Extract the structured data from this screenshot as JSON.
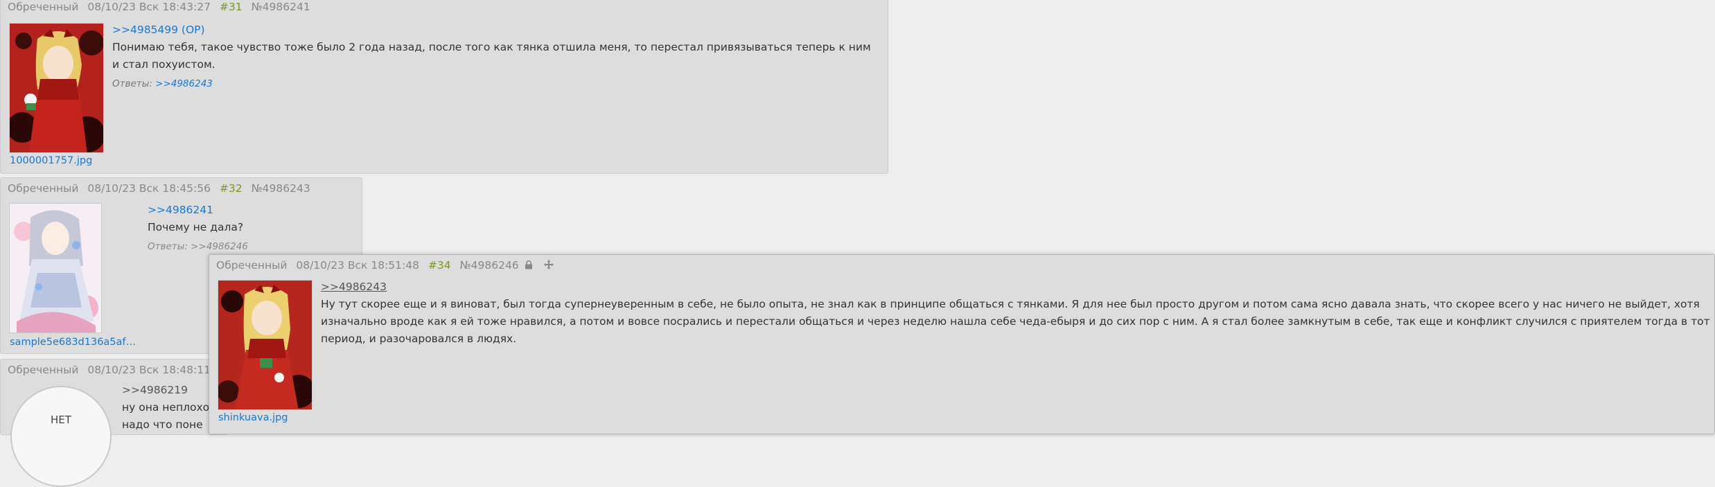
{
  "posts": [
    {
      "author": "Обреченный",
      "datetime": "08/10/23 Вск 18:43:27",
      "postnum": "#31",
      "id": "№4986241",
      "reply_to": ">>4985499 (OP)",
      "text_lines": [
        "Понимаю тебя, такое чувство тоже было 2 года назад, после того как тянка отшила меня, то перестал привязываться теперь к ним",
        "и стал похуистом."
      ],
      "answers_label": "Ответы:",
      "answers_link": ">>4986243",
      "file_name": "1000001757.jpg"
    },
    {
      "author": "Обреченный",
      "datetime": "08/10/23 Вск 18:45:56",
      "postnum": "#32",
      "id": "№4986243",
      "reply_to": ">>4986241",
      "text_lines": [
        "Почему не дала?"
      ],
      "answers_label": "Ответы:",
      "answers_link": ">>4986246",
      "file_name": "sample5e683d136a5af853..."
    },
    {
      "author": "Обреченный",
      "datetime": "08/10/23 Вск 18:48:11",
      "reply_to": ">>4986219",
      "text_lines": [
        "ну она неплохо",
        "надо что поне"
      ],
      "no_image_label": "НЕТ"
    }
  ],
  "popup": {
    "author": "Обреченный",
    "datetime": "08/10/23 Вск 18:51:48",
    "postnum": "#34",
    "id": "№4986246",
    "lock_icon": "lock-icon",
    "move_icon": "move-icon",
    "reply_to": ">>4986243",
    "text_lines": [
      "Ну тут скорее еще и я виноват, был тогда супернеуверенным в себе, не было опыта, не знал как в принципе общаться с тянками. Я для нее был просто другом и потом сама ясно давала знать, что скорее всего у нас ничего не выйдет, хотя",
      "изначально вроде как я ей тоже нравился, а потом и вовсе посрались и перестали общаться и через неделю нашла себе чеда-ебыря и до сих пор с ним. А я стал более замкнутым в себе, так еще и конфликт случился с приятелем тогда в тот",
      "период, и разочаровался в людях."
    ],
    "file_name": "shinkuava.jpg"
  },
  "colors": {
    "background": "#eeeeee",
    "post_background": "#dddddd",
    "link": "#1778d2",
    "postnum": "#789922",
    "meta": "#888888"
  }
}
